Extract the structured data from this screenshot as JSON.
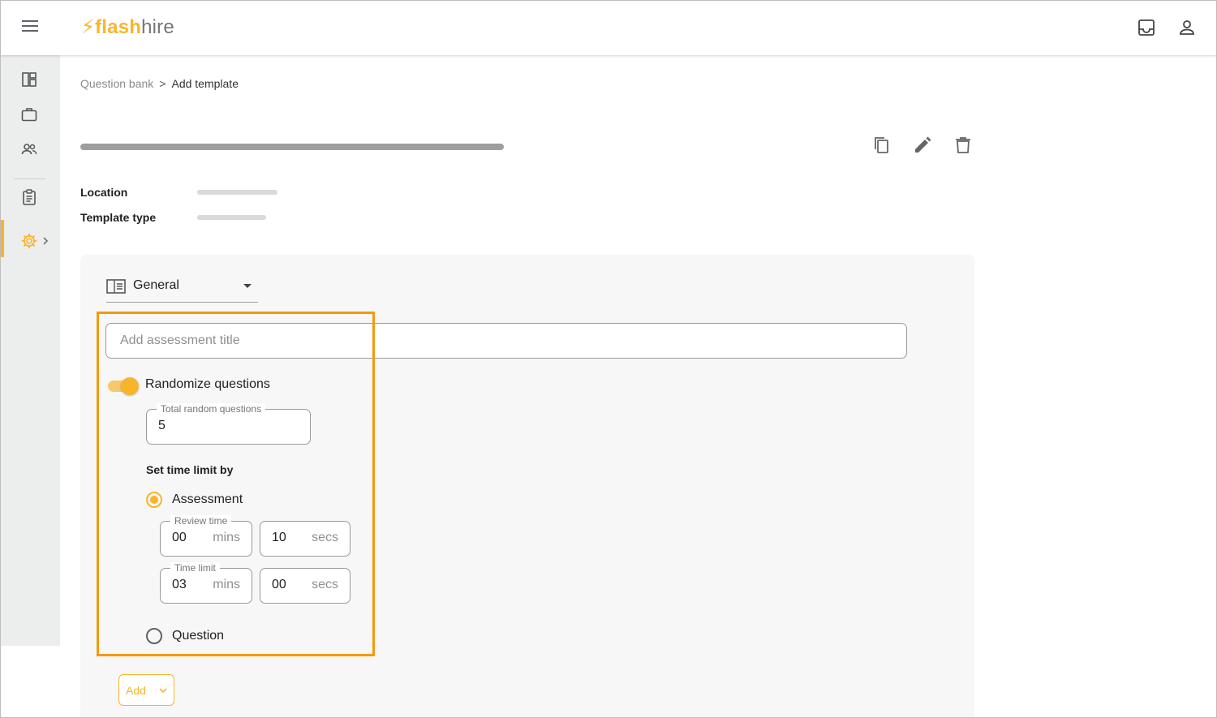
{
  "app": {
    "logo_bolt": "⚡",
    "logo_flash": "flash",
    "logo_hire": "hire"
  },
  "header": {
    "icons": [
      "inbox-icon",
      "account-icon"
    ]
  },
  "sidebar": {
    "items": [
      {
        "name": "dashboard-icon"
      },
      {
        "name": "briefcase-icon"
      },
      {
        "name": "people-icon"
      },
      {
        "name": "clipboard-icon"
      },
      {
        "name": "settings-icon",
        "active": true
      }
    ]
  },
  "breadcrumb": {
    "parent": "Question bank",
    "separator": ">",
    "current": "Add template"
  },
  "template": {
    "actions": [
      "copy-icon",
      "edit-icon",
      "delete-icon"
    ],
    "location_label": "Location",
    "template_type_label": "Template type"
  },
  "section": {
    "selected": "General",
    "icon": "view-sidebar-icon"
  },
  "assessment": {
    "title_placeholder": "Add assessment title",
    "randomize_label": "Randomize questions",
    "randomize_on": true,
    "total_random_label": "Total random questions",
    "total_random_value": "5",
    "time_limit_heading": "Set time limit by",
    "option_assessment": "Assessment",
    "option_question": "Question",
    "selected_option": "Assessment",
    "review_time_label": "Review time",
    "review_mins": "00",
    "review_secs": "10",
    "time_limit_label": "Time limit",
    "limit_mins": "03",
    "limit_secs": "00",
    "mins_unit": "mins",
    "secs_unit": "secs"
  },
  "footer": {
    "add_label": "Add"
  },
  "colors": {
    "accent": "#f9b52a",
    "highlight": "#f39a0d"
  }
}
